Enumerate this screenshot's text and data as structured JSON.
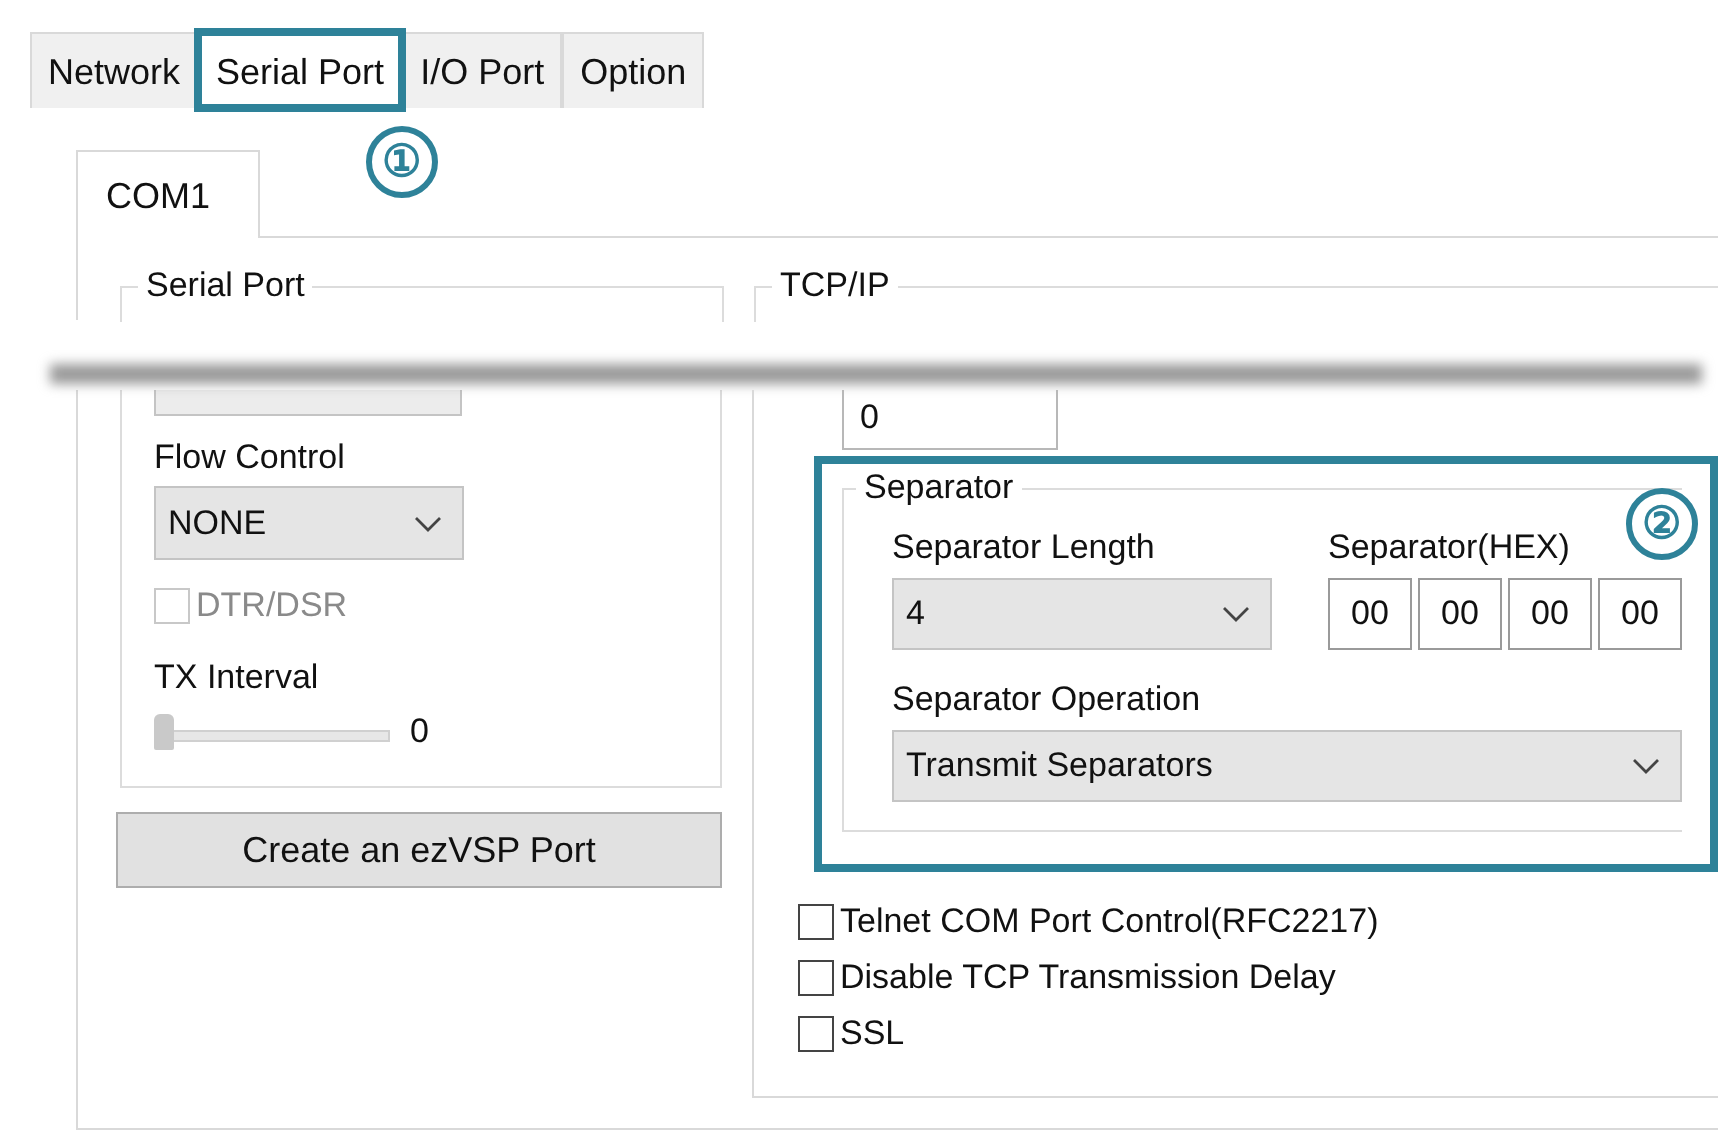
{
  "tabs": [
    {
      "label": "Network",
      "selected": false,
      "highlighted": false
    },
    {
      "label": "Serial Port",
      "selected": true,
      "highlighted": true
    },
    {
      "label": "I/O Port",
      "selected": false,
      "highlighted": false
    },
    {
      "label": "Option",
      "selected": false,
      "highlighted": false
    }
  ],
  "callouts": [
    {
      "label": "①"
    },
    {
      "label": "②"
    }
  ],
  "port_tabs": [
    {
      "label": "COM1",
      "selected": true
    }
  ],
  "serial_port": {
    "title": "Serial Port",
    "flow_control": {
      "label": "Flow Control",
      "value": "NONE"
    },
    "dtr_dsr": {
      "label": "DTR/DSR",
      "checked": false,
      "disabled": true
    },
    "tx_interval": {
      "label": "TX Interval",
      "level": 0,
      "reading": "0"
    }
  },
  "create_button": "Create an ezVSP Port",
  "tcp_ip": {
    "title": "TCP/IP",
    "field_value": "0",
    "separator": {
      "title": "Separator",
      "highlighted": true,
      "length": {
        "label": "Separator Length",
        "value": "4"
      },
      "hex": {
        "label": "Separator(HEX)",
        "values": [
          "00",
          "00",
          "00",
          "00"
        ]
      },
      "operation": {
        "label": "Separator Operation",
        "value": "Transmit Separators"
      }
    },
    "options": [
      {
        "label": "Telnet COM Port Control(RFC2217)",
        "checked": false
      },
      {
        "label": "Disable TCP Transmission Delay",
        "checked": false
      },
      {
        "label": "SSL",
        "checked": false
      }
    ]
  }
}
